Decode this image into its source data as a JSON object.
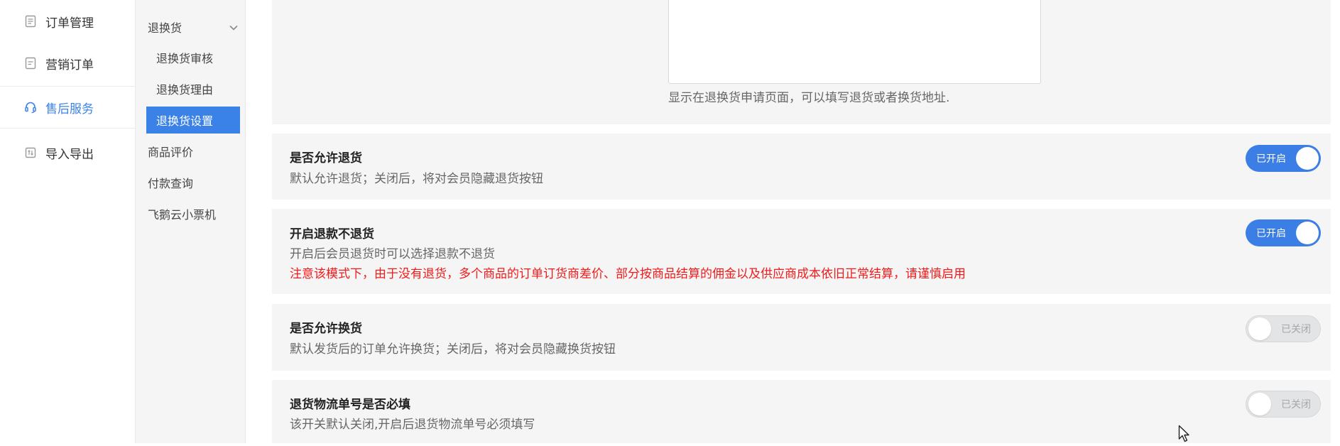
{
  "primary_nav": {
    "items": [
      {
        "label": "订单管理",
        "icon": "order-doc-icon",
        "active": false
      },
      {
        "label": "营销订单",
        "icon": "marketing-doc-icon",
        "active": false
      },
      {
        "label": "售后服务",
        "icon": "headset-icon",
        "active": true
      },
      {
        "label": "导入导出",
        "icon": "import-export-icon",
        "active": false
      }
    ]
  },
  "secondary_nav": {
    "group_label": "退换货",
    "group_icon": "chevron-down-icon",
    "sub_items": [
      {
        "label": "退换货审核",
        "active": false
      },
      {
        "label": "退换货理由",
        "active": false
      },
      {
        "label": "退换货设置",
        "active": true
      }
    ],
    "items": [
      {
        "label": "商品评价"
      },
      {
        "label": "付款查询"
      },
      {
        "label": "飞鹅云小票机"
      }
    ]
  },
  "address_section": {
    "textarea_value": "",
    "hint": "显示在退换货申请页面，可以填写退货或者换货地址."
  },
  "settings": [
    {
      "title": "是否允许退货",
      "desc": "默认允许退货；关闭后，将对会员隐藏退货按钮",
      "warning": "",
      "toggle_label": "已开启",
      "enabled": true
    },
    {
      "title": "开启退款不退货",
      "desc": "开启后会员退货时可以选择退款不退货",
      "warning": "注意该模式下，由于没有退货，多个商品的订单订货商差价、部分按商品结算的佣金以及供应商成本依旧正常结算，请谨慎启用",
      "toggle_label": "已开启",
      "enabled": true
    },
    {
      "title": "是否允许换货",
      "desc": "默认发货后的订单允许换货；关闭后，将对会员隐藏换货按钮",
      "warning": "",
      "toggle_label": "已关闭",
      "enabled": false
    },
    {
      "title": "退货物流单号是否必填",
      "desc": "该开关默认关闭,开启后退货物流单号必须填写",
      "warning": "",
      "toggle_label": "已关闭",
      "enabled": false
    }
  ],
  "colors": {
    "accent": "#3b82e8",
    "toggle_on": "#3b7fe6",
    "toggle_off": "#e3e4e6",
    "warning": "#f21b1b",
    "card_bg": "#f5f5f5"
  }
}
